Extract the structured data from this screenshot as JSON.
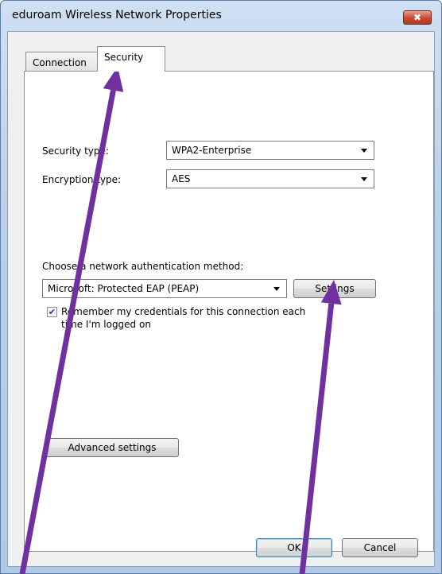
{
  "window": {
    "title": "eduroam Wireless Network Properties",
    "close_label": "✖"
  },
  "tabs": [
    {
      "label": "Connection",
      "active": false
    },
    {
      "label": "Security",
      "active": true
    }
  ],
  "security": {
    "security_type_label": "Security type:",
    "security_type_value": "WPA2-Enterprise",
    "encryption_type_label": "Encryption type:",
    "encryption_type_value": "AES",
    "auth_method_label": "Choose a network authentication method:",
    "auth_method_value": "Microsoft: Protected EAP (PEAP)",
    "settings_button": "Settings",
    "remember_credentials_line1": "Remember my credentials for this connection each",
    "remember_credentials_line2": "time I'm logged on",
    "remember_credentials_checked": true,
    "advanced_settings_button": "Advanced settings"
  },
  "footer": {
    "ok_button": "OK",
    "cancel_button": "Cancel"
  },
  "annotations": {
    "arrow_color": "#7030a0"
  },
  "icons": {
    "dropdown": "chevron-down-icon",
    "checkmark": "checkmark-icon"
  }
}
